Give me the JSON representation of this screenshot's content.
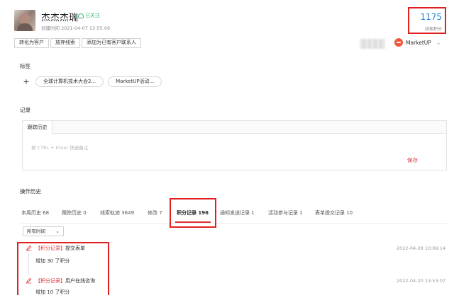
{
  "header": {
    "name": "杰杰杰瑞",
    "follow_label": "已关注",
    "created_label": "创建时间",
    "created_time": "2021-04-07 13:55:06",
    "buttons": [
      "转化为客户",
      "放弃线索",
      "添加为已有客户联系人"
    ],
    "score_value": "1175",
    "score_label": "线索积分",
    "brand_name": "MarketUP"
  },
  "tags_section": {
    "title": "标签",
    "add_symbol": "+",
    "tags": [
      "全球计算机技术大会2...",
      "MarketUP活动..."
    ]
  },
  "notes_section": {
    "title": "记录",
    "tab_label": "跟踪历史",
    "placeholder": "按 CTRL + Enter 快速备注",
    "save_label": "保存"
  },
  "history_section": {
    "title": "操作历史",
    "tabs": [
      "本周历史 68",
      "跟踪历史 0",
      "线索轨迹 3649",
      "修改 7",
      "积分记录 196",
      "通知发送记录 1",
      "活动参与记录 1",
      "表单提交记录 10"
    ],
    "active_tab_index": 4,
    "time_filter": "所有时间",
    "records": [
      {
        "tag": "【积分记录】",
        "title": "提交表单",
        "desc": "增加 30 了积分",
        "time": "2022-04-28 10:09:14"
      },
      {
        "tag": "【积分记录】",
        "title": "用户在线咨询",
        "desc": "增加 10 了积分",
        "time": "2022-04-20 13:53:07"
      }
    ]
  },
  "colors": {
    "accent_red": "#e0303a",
    "highlight_box": "#e02020",
    "score_blue": "#1e7fd6",
    "follow_green": "#3cb371",
    "brand_orange": "#ef5a3c"
  }
}
